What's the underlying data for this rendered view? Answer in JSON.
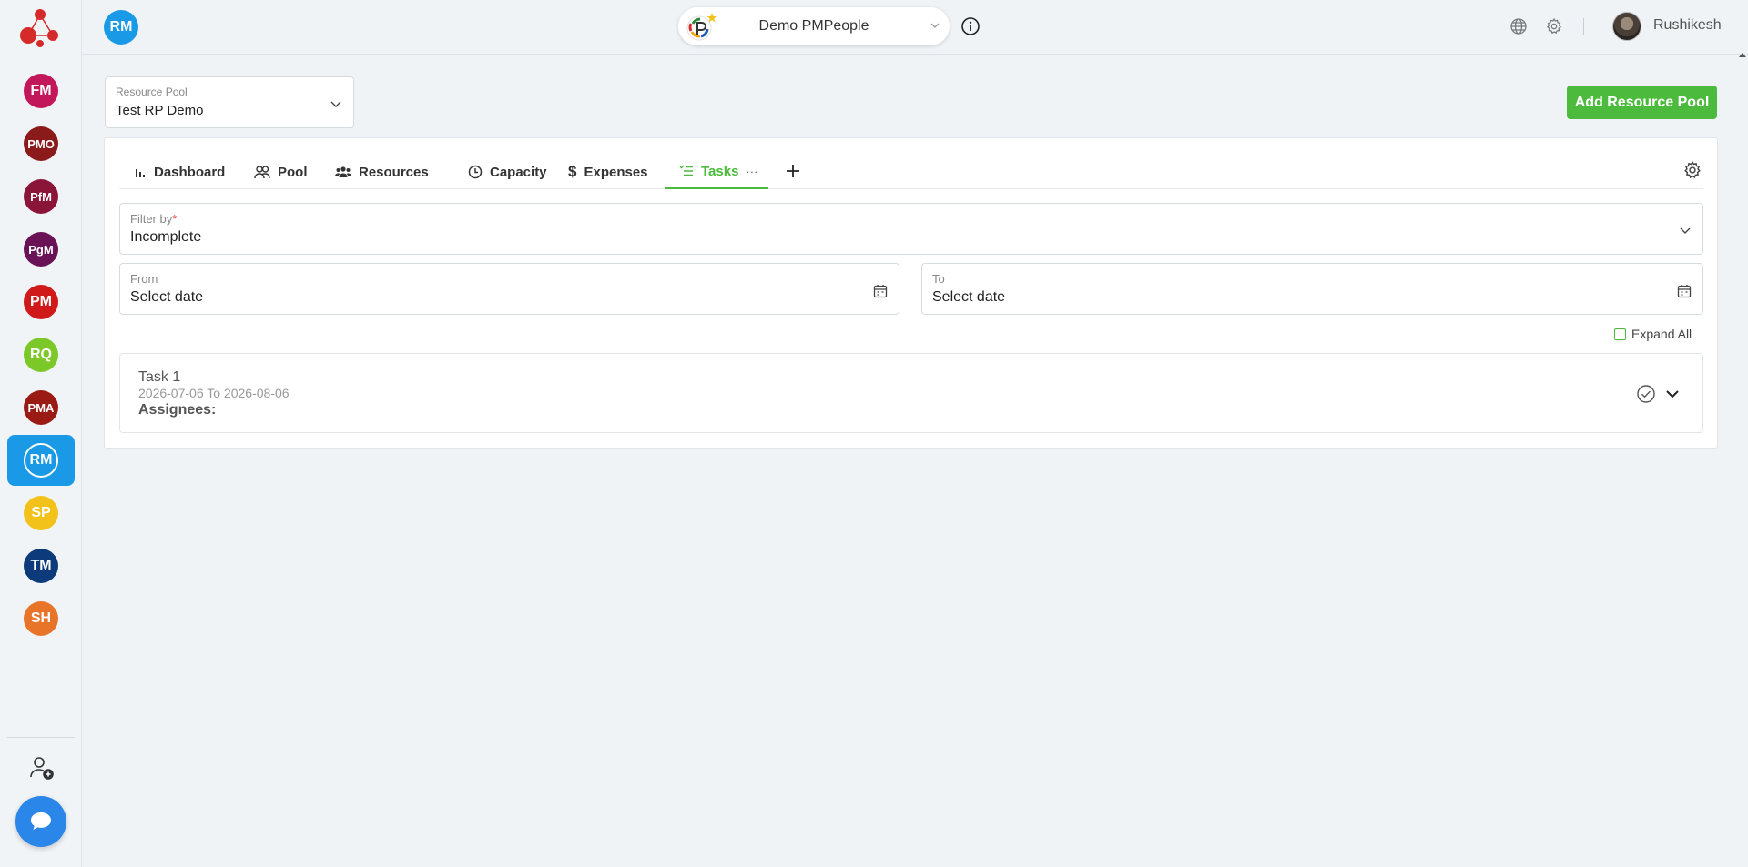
{
  "sidebar": {
    "items": [
      {
        "abbr": "FM",
        "color": "#c2185b",
        "active": false
      },
      {
        "abbr": "PMO",
        "color": "#8b1a1a",
        "active": false
      },
      {
        "abbr": "PfM",
        "color": "#8b1538",
        "active": false
      },
      {
        "abbr": "PgM",
        "color": "#6a1256",
        "active": false
      },
      {
        "abbr": "PM",
        "color": "#d01a1a",
        "active": false
      },
      {
        "abbr": "RQ",
        "color": "#7cc828",
        "active": false
      },
      {
        "abbr": "PMA",
        "color": "#9a1a14",
        "active": false
      },
      {
        "abbr": "RM",
        "color": "#1a9ae6",
        "active": true
      },
      {
        "abbr": "SP",
        "color": "#f2c21b",
        "active": false
      },
      {
        "abbr": "TM",
        "color": "#0d3a7a",
        "active": false
      },
      {
        "abbr": "SH",
        "color": "#e8742a",
        "active": false
      }
    ]
  },
  "header": {
    "module_badge": "RM",
    "workspace_name": "Demo PMPeople",
    "user_name": "Rushikesh"
  },
  "pool": {
    "label": "Resource Pool",
    "value": "Test RP Demo",
    "add_button": "Add Resource Pool"
  },
  "tabs": [
    {
      "label": "Dashboard",
      "icon": "bar-chart-icon"
    },
    {
      "label": "Pool",
      "icon": "group-icon"
    },
    {
      "label": "Resources",
      "icon": "people-icon"
    },
    {
      "label": "Capacity",
      "icon": "clock-icon"
    },
    {
      "label": "Expenses",
      "icon": "dollar-icon"
    },
    {
      "label": "Tasks",
      "icon": "list-icon",
      "active": true,
      "more": "···"
    }
  ],
  "filter": {
    "label": "Filter by",
    "required_mark": "*",
    "value": "Incomplete"
  },
  "date_from": {
    "label": "From",
    "placeholder": "Select date"
  },
  "date_to": {
    "label": "To",
    "placeholder": "Select date"
  },
  "expand_all": "Expand All",
  "task": {
    "title": "Task 1",
    "dates": "2026-07-06 To 2026-08-06",
    "assignees_label": "Assignees:"
  },
  "colors": {
    "accent_green": "#4cba3c",
    "accent_blue": "#1a9ae6"
  }
}
